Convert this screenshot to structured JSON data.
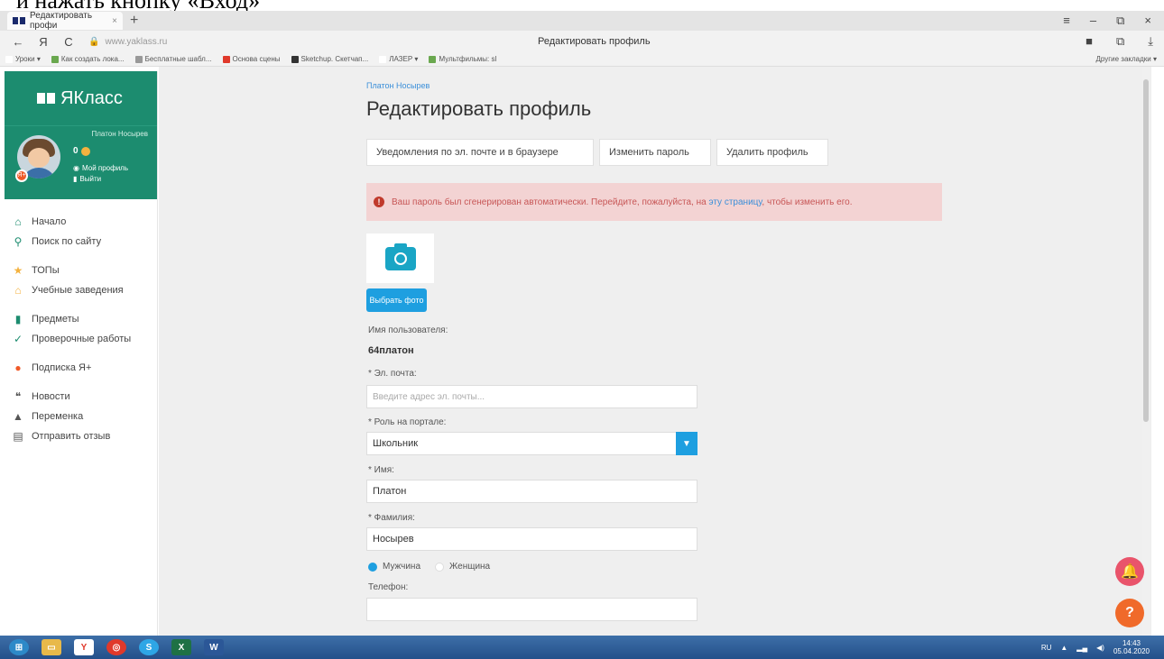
{
  "caption": "и нажать кнопку «Вход»",
  "browser": {
    "tab_title": "Редактировать профи",
    "tab_close": "×",
    "new_tab": "+",
    "window_controls": [
      "≡",
      "–",
      "⧉",
      "×"
    ],
    "back": "←",
    "yandex": "Я",
    "reload": "C",
    "url": "www.yaklass.ru",
    "page_title": "Редактировать профиль",
    "bookmarks": [
      {
        "label": "Уроки ▾",
        "color": "#ffffff"
      },
      {
        "label": "Как создать лока...",
        "color": "#6aa84f"
      },
      {
        "label": "Бесплатные шабл...",
        "color": "#999999"
      },
      {
        "label": "Основа сцены",
        "color": "#e0392b"
      },
      {
        "label": "Sketchup. Скетчап...",
        "color": "#333333"
      },
      {
        "label": "ЛАЗЕР ▾",
        "color": "#ffffff"
      },
      {
        "label": "Мультфильмы: sl",
        "color": "#6aa84f"
      }
    ],
    "bookmarks_other": "Другие закладки ▾"
  },
  "sidebar": {
    "brand": "ЯКласс",
    "user_name": "Платон Носырев",
    "score": "0",
    "my_profile": "Мой профиль",
    "logout": "Выйти",
    "menu": [
      {
        "label": "Начало",
        "icon": "home-icon",
        "glyph": "⌂",
        "color": "#1c8c6f",
        "name": "home"
      },
      {
        "label": "Поиск по сайту",
        "icon": "search-icon",
        "glyph": "⚲",
        "color": "#1c8c6f",
        "name": "search"
      },
      {
        "gap": true
      },
      {
        "label": "ТОПы",
        "icon": "star-icon",
        "glyph": "★",
        "color": "#f4b23f",
        "name": "tops"
      },
      {
        "label": "Учебные заведения",
        "icon": "institution-icon",
        "glyph": "⌂",
        "color": "#f4b23f",
        "name": "schools"
      },
      {
        "gap": true
      },
      {
        "label": "Предметы",
        "icon": "books-icon",
        "glyph": "▮",
        "color": "#1c8c6f",
        "name": "subjects"
      },
      {
        "label": "Проверочные работы",
        "icon": "check-circle-icon",
        "glyph": "✓",
        "color": "#1c8c6f",
        "name": "tests"
      },
      {
        "gap": true
      },
      {
        "label": "Подписка Я+",
        "icon": "subscription-icon",
        "glyph": "●",
        "color": "#f05a28",
        "name": "subscription"
      },
      {
        "gap": true
      },
      {
        "label": "Новости",
        "icon": "news-icon",
        "glyph": "❝",
        "color": "#555555",
        "name": "news"
      },
      {
        "label": "Переменка",
        "icon": "bell-icon",
        "glyph": "▲",
        "color": "#555555",
        "name": "break"
      },
      {
        "label": "Отправить отзыв",
        "icon": "feedback-icon",
        "glyph": "▤",
        "color": "#555555",
        "name": "feedback"
      }
    ]
  },
  "main": {
    "breadcrumb": "Платон Носырев",
    "title": "Редактировать профиль",
    "tabs": [
      "Уведомления по эл. почте и в браузере",
      "Изменить пароль",
      "Удалить профиль"
    ],
    "alert": {
      "text_before": "Ваш пароль был сгенерирован автоматически. Перейдите, пожалуйста, на ",
      "link": "эту страницу",
      "text_after": ", чтобы изменить его."
    },
    "photo_button": "Выбрать фото",
    "username_label": "Имя пользователя:",
    "username_value": "64платон",
    "email_label": "* Эл. почта:",
    "email_placeholder": "Введите адрес эл. почты...",
    "role_label": "* Роль на портале:",
    "role_value": "Школьник",
    "first_name_label": "* Имя:",
    "first_name_value": "Платон",
    "last_name_label": "* Фамилия:",
    "last_name_value": "Носырев",
    "gender_options": [
      "Мужчина",
      "Женщина"
    ],
    "gender_selected": "Мужчина",
    "phone_label": "Телефон:",
    "phone_value": ""
  },
  "taskbar": {
    "apps": [
      "windows",
      "explorer",
      "yandex",
      "chrome",
      "skype",
      "excel",
      "word"
    ],
    "lang": "RU",
    "time": "14:43",
    "date": "05.04.2020"
  },
  "colors": {
    "brand_green": "#1c8c6f",
    "accent_blue": "#1e9fe0",
    "alert_bg": "#f3d3d3",
    "alert_text": "#c75656"
  }
}
